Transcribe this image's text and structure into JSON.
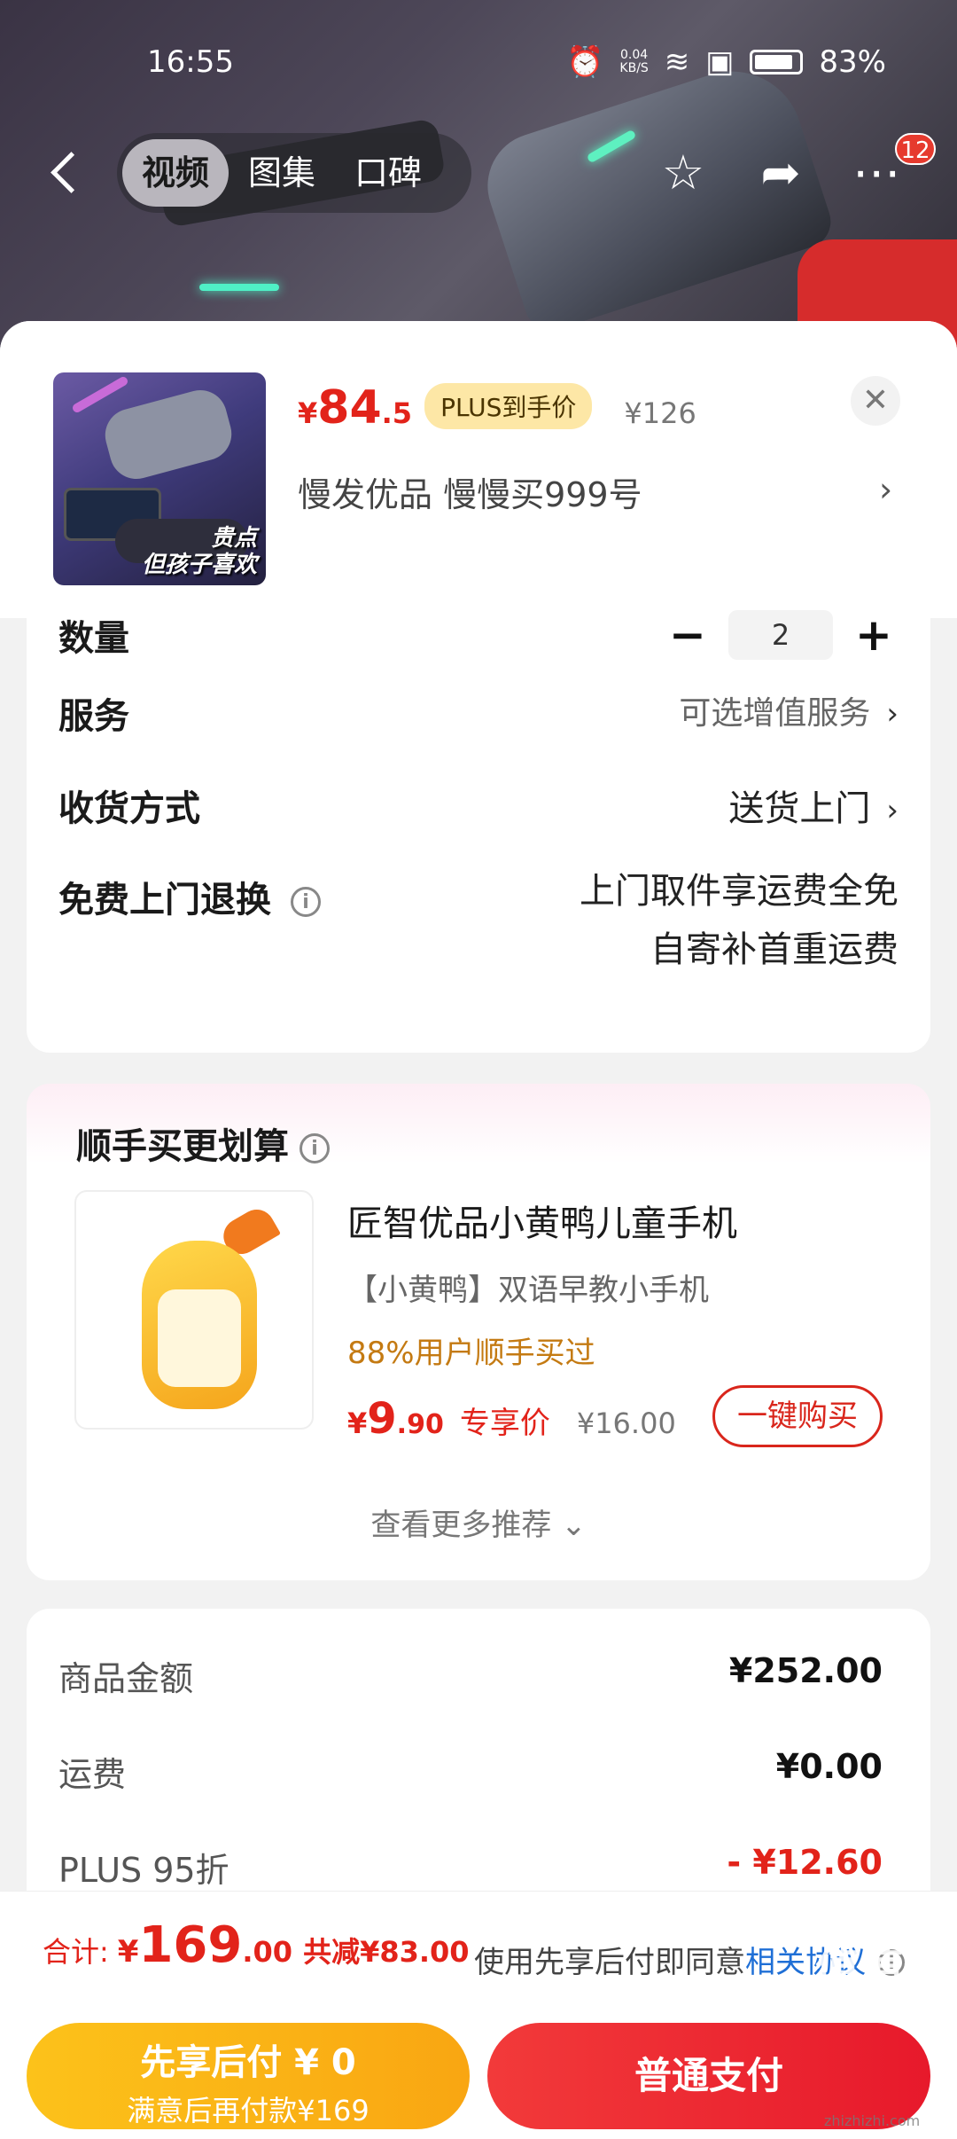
{
  "status": {
    "time": "16:55",
    "net_speed": "0.04",
    "net_unit": "KB/S",
    "battery": "83%"
  },
  "nav": {
    "tabs": [
      {
        "label": "视频"
      },
      {
        "label": "图集"
      },
      {
        "label": "口碑"
      }
    ],
    "message_count": "12"
  },
  "product": {
    "thumb_caption_line1": "贵点",
    "thumb_caption_line2": "但孩子喜欢",
    "price_currency": "¥",
    "price_int": "84",
    "price_dec": ".5",
    "plus_tag": "PLUS到手价",
    "original_price": "¥126",
    "variant": "慢发优品  慢慢买999号"
  },
  "options": {
    "quantity_label": "数量",
    "quantity_value": "2",
    "service_label": "服务",
    "service_value": "可选增值服务",
    "delivery_label": "收货方式",
    "delivery_value": "送货上门",
    "return_label": "免费上门退换",
    "return_line1": "上门取件享运费全免",
    "return_line2": "自寄补首重运费"
  },
  "recommend": {
    "title": "顺手买更划算",
    "name": "匠智优品小黄鸭儿童手机",
    "subtitle": "【小黄鸭】双语早教小手机",
    "stat": "88%用户顺手买过",
    "price_currency": "¥",
    "price_int": "9",
    "price_dec": ".90",
    "price_tag": "专享价",
    "original_price": "¥16.00",
    "buy_label": "一键购买",
    "more_label": "查看更多推荐"
  },
  "summary": {
    "rows": [
      {
        "label": "商品金额",
        "amount": "¥252.00"
      },
      {
        "label": "运费",
        "amount": "¥0.00"
      },
      {
        "label": "PLUS 95折",
        "amount": "- ¥12.60"
      }
    ]
  },
  "bottom": {
    "total_label": "合计:",
    "total_currency": "¥",
    "total_int": "169",
    "total_dec": ".00",
    "saved": "共减¥83.00",
    "agree_text": "使用先享后付即同意",
    "agree_link": "相关协议",
    "pay_later_line1": "先享后付 ¥ 0",
    "pay_later_line2": "满意后再付款¥169",
    "pay_normal": "普通支付"
  },
  "watermark": {
    "text": "值值值",
    "sub": "zhizhizhi.com"
  },
  "colors": {
    "accent_red": "#e2231a",
    "pay_yellow": "#fcc21a",
    "link_blue": "#1f6fd6"
  }
}
